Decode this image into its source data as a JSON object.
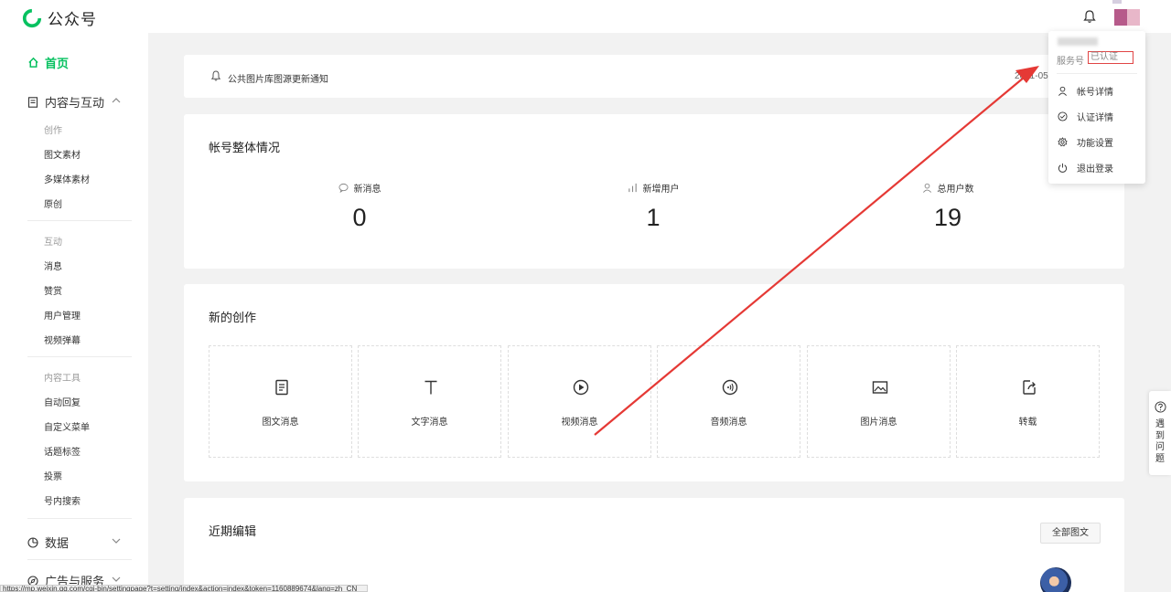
{
  "app": {
    "title": "公众号"
  },
  "sidebar": {
    "home": "首页",
    "content_group": "内容与互动",
    "sections": {
      "create": "创作",
      "interact": "互动",
      "tools": "内容工具"
    },
    "items": {
      "articles": "图文素材",
      "media": "多媒体素材",
      "original": "原创",
      "messages": "消息",
      "reward": "赞赏",
      "users": "用户管理",
      "danmaku": "视频弹幕",
      "autoreply": "自动回复",
      "menu": "自定义菜单",
      "tags": "话题标签",
      "vote": "投票",
      "search": "号内搜索"
    },
    "data_group": "数据",
    "ads_group": "广告与服务"
  },
  "notice": {
    "text": "公共图片库图源更新通知",
    "date": "2021-05"
  },
  "overview": {
    "title": "帐号整体情况",
    "stats": [
      {
        "label": "新消息",
        "value": "0"
      },
      {
        "label": "新增用户",
        "value": "1"
      },
      {
        "label": "总用户数",
        "value": "19"
      }
    ]
  },
  "create": {
    "title": "新的创作",
    "tiles": [
      "图文消息",
      "文字消息",
      "视频消息",
      "音频消息",
      "图片消息",
      "转载"
    ]
  },
  "recent": {
    "title": "近期编辑",
    "all_button": "全部图文"
  },
  "dropdown": {
    "type": "服务号",
    "verified": "已认证",
    "items": [
      "帐号详情",
      "认证详情",
      "功能设置",
      "退出登录"
    ]
  },
  "help": {
    "text": "遇到问题"
  },
  "statusbar": {
    "url": "https://mp.weixin.qq.com/cgi-bin/settingpage?t=setting/index&action=index&token=1160889674&lang=zh_CN"
  },
  "colors": {
    "accent": "#07c160",
    "annotation": "#e53935"
  }
}
